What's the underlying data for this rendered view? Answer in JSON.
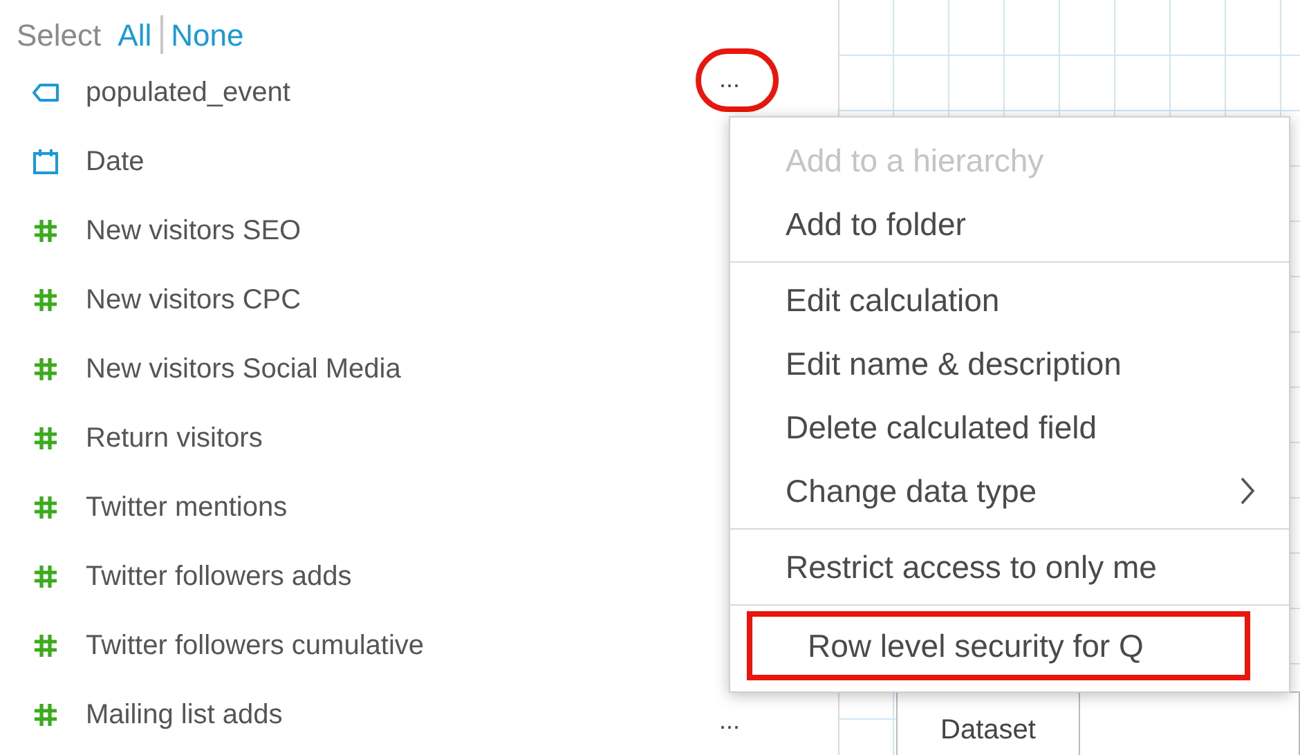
{
  "select_bar": {
    "label": "Select",
    "links": [
      "All",
      "None"
    ]
  },
  "fields": [
    {
      "name": "populated_event",
      "kind": "string",
      "menu_button": "...",
      "circled": true
    },
    {
      "name": "Date",
      "kind": "date"
    },
    {
      "name": "New visitors SEO",
      "kind": "number"
    },
    {
      "name": "New visitors CPC",
      "kind": "number"
    },
    {
      "name": "New visitors Social Media",
      "kind": "number"
    },
    {
      "name": "Return visitors",
      "kind": "number"
    },
    {
      "name": "Twitter mentions",
      "kind": "number"
    },
    {
      "name": "Twitter followers adds",
      "kind": "number"
    },
    {
      "name": "Twitter followers cumulative",
      "kind": "number"
    },
    {
      "name": "Mailing list adds",
      "kind": "number",
      "menu_button": "...",
      "circled": false
    }
  ],
  "canvas_tab": "Dataset",
  "context_menu": {
    "groups": [
      [
        {
          "label": "Add to a hierarchy",
          "disabled": true,
          "submenu": false,
          "highlighted": false
        },
        {
          "label": "Add to folder",
          "disabled": false,
          "submenu": false,
          "highlighted": false
        }
      ],
      [
        {
          "label": "Edit calculation",
          "disabled": false,
          "submenu": false,
          "highlighted": false
        },
        {
          "label": "Edit name & description",
          "disabled": false,
          "submenu": false,
          "highlighted": false
        },
        {
          "label": "Delete calculated field",
          "disabled": false,
          "submenu": false,
          "highlighted": false
        },
        {
          "label": "Change data type",
          "disabled": false,
          "submenu": true,
          "highlighted": false
        }
      ],
      [
        {
          "label": "Restrict access to only me",
          "disabled": false,
          "submenu": false,
          "highlighted": false
        }
      ],
      [
        {
          "label": "Row level security for Q",
          "disabled": false,
          "submenu": false,
          "highlighted": true
        }
      ]
    ]
  }
}
